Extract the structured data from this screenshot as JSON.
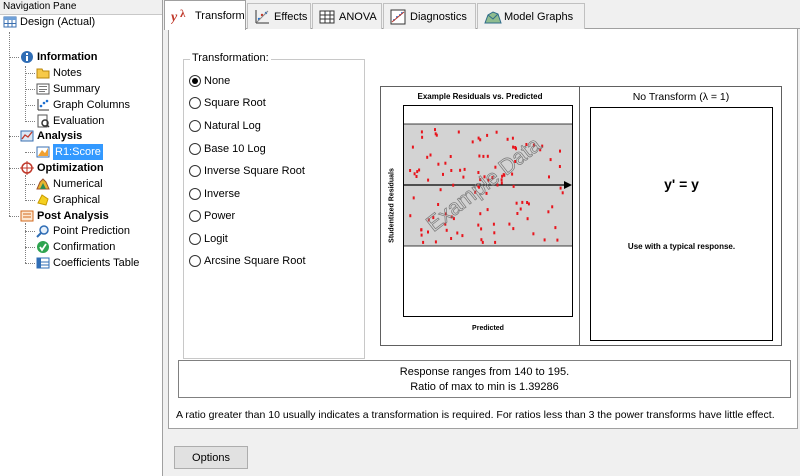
{
  "nav": {
    "title": "Navigation Pane",
    "design": "Design (Actual)",
    "information": "Information",
    "notes": "Notes",
    "summary": "Summary",
    "graph_columns": "Graph Columns",
    "evaluation": "Evaluation",
    "analysis": "Analysis",
    "r1_score": "R1:Score",
    "optimization": "Optimization",
    "numerical": "Numerical",
    "graphical": "Graphical",
    "post_analysis": "Post Analysis",
    "point_prediction": "Point Prediction",
    "confirmation": "Confirmation",
    "coefficients_table": "Coefficients Table"
  },
  "tabs": {
    "transform": "Transform",
    "effects": "Effects",
    "anova": "ANOVA",
    "diagnostics": "Diagnostics",
    "model_graphs": "Model Graphs"
  },
  "transformation": {
    "group_title": "Transformation:",
    "options": [
      "None",
      "Square Root",
      "Natural Log",
      "Base 10 Log",
      "Inverse Square Root",
      "Inverse",
      "Power",
      "Logit",
      "Arcsine Square Root"
    ],
    "selected": "None"
  },
  "example": {
    "title": "Example Residuals vs. Predicted",
    "ylabel": "Studentized Residuals",
    "xlabel": "Predicted",
    "watermark": "Example Data",
    "right_title": "No Transform (λ = 1)",
    "formula": "y' = y",
    "description": "Use with a typical response."
  },
  "response": {
    "line1": "Response ranges from 140 to 195.",
    "line2": "Ratio of max to min is 1.39286"
  },
  "note": "A ratio greater than 10 usually indicates a transformation is required. For ratios less than 3 the power transforms have little effect.",
  "buttons": {
    "options": "Options"
  },
  "colors": {
    "selection": "#3399ff",
    "points": "#e8141c",
    "plot_band": "#d3d3d3"
  }
}
